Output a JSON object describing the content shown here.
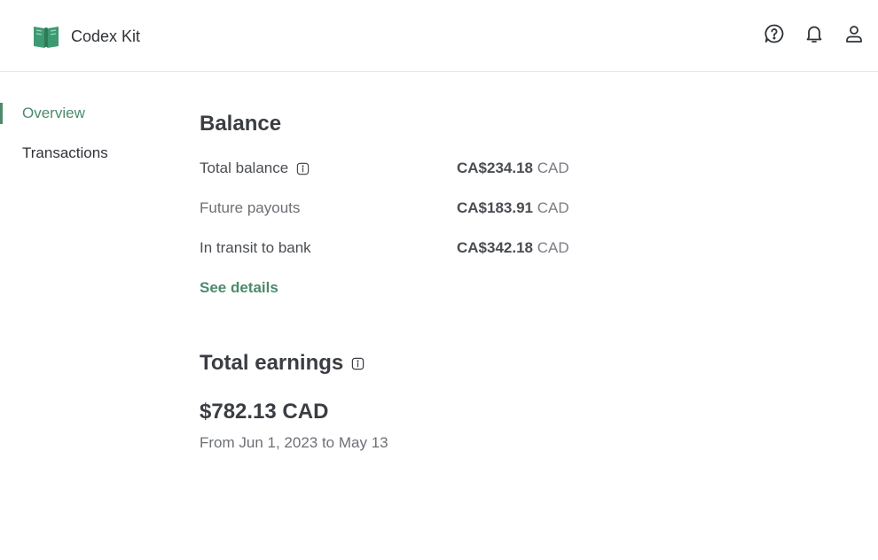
{
  "app": {
    "name": "Codex Kit",
    "logo_icon": "book-logo-icon",
    "accent": "#4d8a6c"
  },
  "header": {
    "icons": [
      "help-icon",
      "bell-icon",
      "user-icon"
    ]
  },
  "sidebar": {
    "items": [
      {
        "label": "Overview",
        "active": true
      },
      {
        "label": "Transactions",
        "active": false
      }
    ]
  },
  "balance": {
    "title": "Balance",
    "rows": [
      {
        "label": "Total balance",
        "amount": "CA$234.18",
        "currency": "CAD"
      },
      {
        "label": "Future payouts",
        "amount": "CA$183.91",
        "currency": "CAD"
      },
      {
        "label": "In transit to bank",
        "amount": "CA$342.18",
        "currency": "CAD"
      }
    ],
    "details_link": "See details"
  },
  "earnings": {
    "title": "Total earnings",
    "amount": "$782.13 CAD",
    "period": "From Jun 1, 2023 to May 13"
  }
}
